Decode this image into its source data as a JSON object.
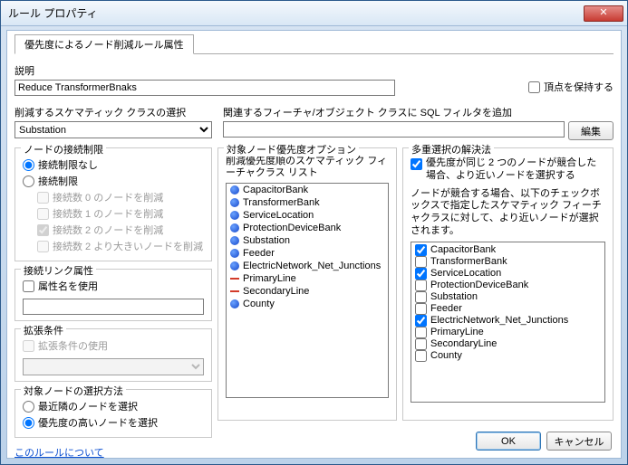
{
  "window": {
    "title": "ルール プロパティ",
    "close_glyph": "✕"
  },
  "tab": {
    "label": "優先度によるノード削減ルール属性"
  },
  "description": {
    "label": "説明",
    "value": "Reduce TransformerBnaks"
  },
  "keep_vertex": {
    "label": "頂点を保持する"
  },
  "schematic_class": {
    "label": "削減するスケマティック クラスの選択",
    "value": "Substation"
  },
  "sql_filter": {
    "label": "関連するフィーチャ/オブジェクト クラスに SQL フィルタを追加",
    "value": "",
    "edit_btn": "編集"
  },
  "connection_limit": {
    "legend": "ノードの接続制限",
    "opt_none": "接続制限なし",
    "opt_limit": "接続制限",
    "chk0": "接続数 0 のノードを削減",
    "chk1": "接続数 1 のノードを削減",
    "chk2": "接続数 2 のノードを削減",
    "chk3": "接続数 2 より大きいノードを削減"
  },
  "link_attr": {
    "legend": "接続リンク属性",
    "chk": "属性名を使用",
    "value": ""
  },
  "ext_cond": {
    "legend": "拡張条件",
    "chk": "拡張条件の使用"
  },
  "target_method": {
    "legend": "対象ノードの選択方法",
    "opt_nearest": "最近隣のノードを選択",
    "opt_high": "優先度の高いノードを選択"
  },
  "help_link": "このルールについて",
  "priority": {
    "legend": "対象ノード優先度オプション",
    "sublabel": "削減優先度順のスケマティック フィーチャクラス リスト",
    "items": [
      {
        "name": "CapacitorBank",
        "kind": "blue"
      },
      {
        "name": "TransformerBank",
        "kind": "blue"
      },
      {
        "name": "ServiceLocation",
        "kind": "blue"
      },
      {
        "name": "ProtectionDeviceBank",
        "kind": "blue"
      },
      {
        "name": "Substation",
        "kind": "blue"
      },
      {
        "name": "Feeder",
        "kind": "blue"
      },
      {
        "name": "ElectricNetwork_Net_Junctions",
        "kind": "blue"
      },
      {
        "name": "PrimaryLine",
        "kind": "red"
      },
      {
        "name": "SecondaryLine",
        "kind": "red"
      },
      {
        "name": "County",
        "kind": "blue"
      }
    ]
  },
  "multi": {
    "legend": "多重選択の解決法",
    "chk_tie": "優先度が同じ 2 つのノードが競合した場合、より近いノードを選択する",
    "note": "ノードが競合する場合、以下のチェックボックスで指定したスケマティック フィーチャクラスに対して、より近いノードが選択されます。",
    "items": [
      {
        "name": "CapacitorBank",
        "checked": true
      },
      {
        "name": "TransformerBank",
        "checked": false
      },
      {
        "name": "ServiceLocation",
        "checked": true
      },
      {
        "name": "ProtectionDeviceBank",
        "checked": false
      },
      {
        "name": "Substation",
        "checked": false
      },
      {
        "name": "Feeder",
        "checked": false
      },
      {
        "name": "ElectricNetwork_Net_Junctions",
        "checked": true
      },
      {
        "name": "PrimaryLine",
        "checked": false
      },
      {
        "name": "SecondaryLine",
        "checked": false
      },
      {
        "name": "County",
        "checked": false
      }
    ]
  },
  "buttons": {
    "ok": "OK",
    "cancel": "キャンセル"
  }
}
